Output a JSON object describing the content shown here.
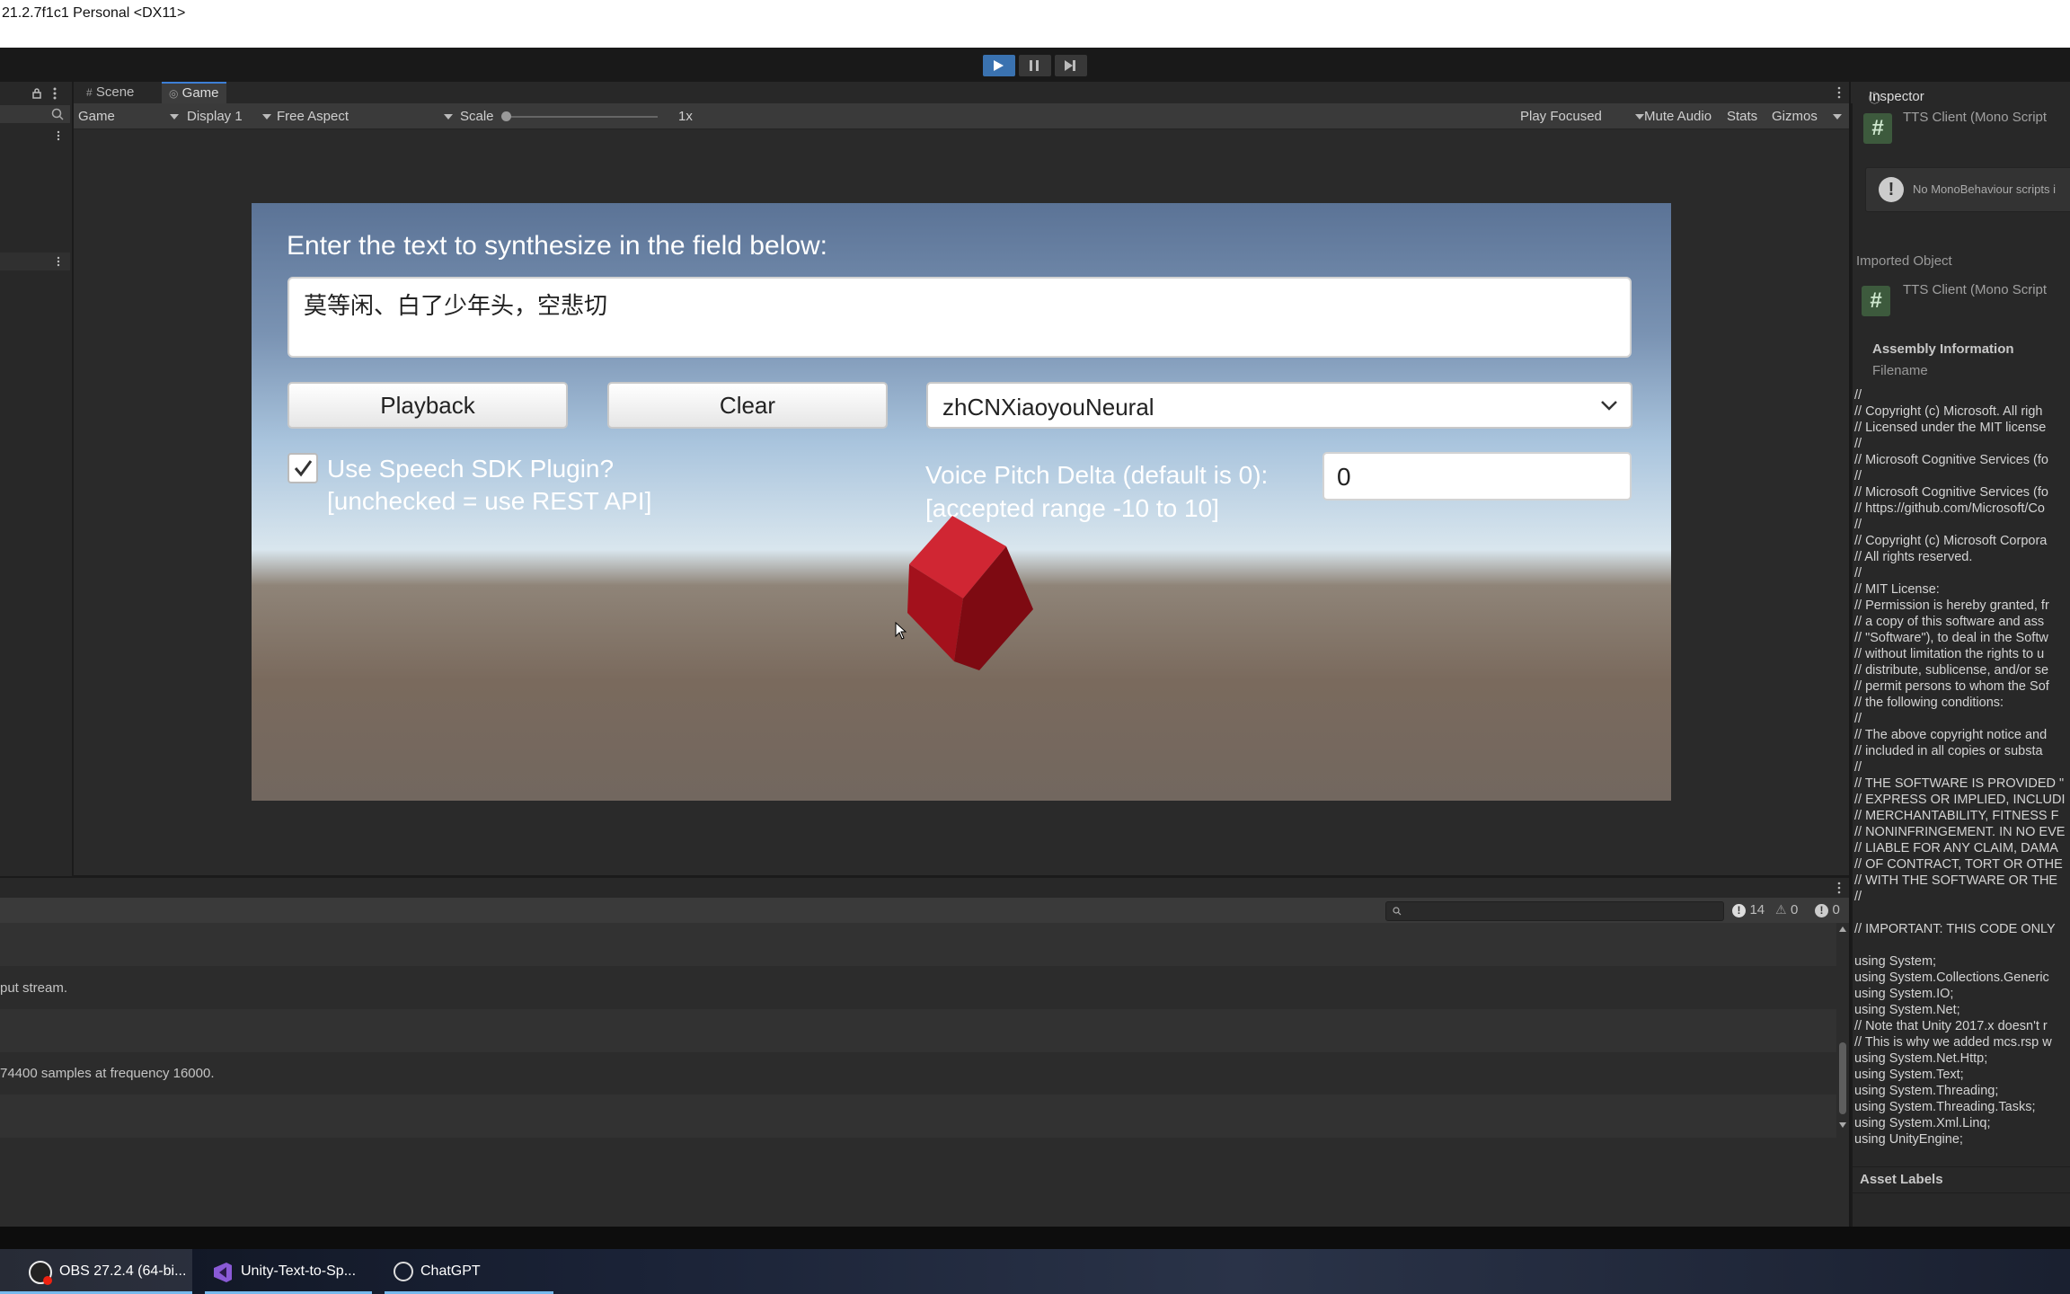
{
  "window": {
    "title": "21.2.7f1c1 Personal <DX11>"
  },
  "game_tabs": {
    "scene": "Scene",
    "game": "Game"
  },
  "game_toolbar": {
    "view": "Game",
    "display": "Display 1",
    "aspect": "Free Aspect",
    "scale_label": "Scale",
    "scale_value": "1x",
    "play_mode": "Play Focused",
    "mute": "Mute Audio",
    "stats": "Stats",
    "gizmos": "Gizmos"
  },
  "game_ui": {
    "prompt": "Enter the text to synthesize in the field below:",
    "input_text": "莫等闲、白了少年头，空悲切",
    "playback_label": "Playback",
    "clear_label": "Clear",
    "voice": "zhCNXiaoyouNeural",
    "sdk_line1": "Use Speech SDK Plugin?",
    "sdk_line2": "[unchecked = use REST API]",
    "pitch_line1": "Voice Pitch Delta (default is 0):",
    "pitch_line2": "[accepted range -10 to 10]",
    "pitch_value": "0"
  },
  "console": {
    "counts": {
      "info": "14",
      "warn": "0",
      "error": "0"
    },
    "rows": [
      "",
      "put stream.",
      "",
      "74400 samples at frequency 16000.",
      "",
      ""
    ]
  },
  "inspector": {
    "tab": "Inspector",
    "title": "TTS Client (Mono Script",
    "warning": "No MonoBehaviour scripts i",
    "imported_object": "Imported Object",
    "title2": "TTS Client (Mono Script",
    "assembly_info": "Assembly Information",
    "filename": "Filename",
    "code": "//\n// Copyright (c) Microsoft. All righ\n// Licensed under the MIT license\n//\n// Microsoft Cognitive Services (fo\n//\n// Microsoft Cognitive Services (fo\n// https://github.com/Microsoft/Co\n//\n// Copyright (c) Microsoft Corpora\n// All rights reserved.\n//\n// MIT License:\n// Permission is hereby granted, fr\n// a copy of this software and ass\n// \"Software\"), to deal in the Softw\n// without limitation the rights to u\n// distribute, sublicense, and/or se\n// permit persons to whom the Sof\n// the following conditions:\n//\n// The above copyright notice and\n// included in all copies or substa\n//\n// THE SOFTWARE IS PROVIDED \"\n// EXPRESS OR IMPLIED, INCLUDI\n// MERCHANTABILITY, FITNESS F\n// NONINFRINGEMENT. IN NO EVE\n// LIABLE FOR ANY CLAIM, DAMA\n// OF CONTRACT, TORT OR OTHE\n// WITH THE SOFTWARE OR THE\n//\n\n// IMPORTANT: THIS CODE ONLY\n\nusing System;\nusing System.Collections.Generic\nusing System.IO;\nusing System.Net;\n// Note that Unity 2017.x doesn't r\n// This is why we added mcs.rsp w\nusing System.Net.Http;\nusing System.Text;\nusing System.Threading;\nusing System.Threading.Tasks;\nusing System.Xml.Linq;\nusing UnityEngine;",
    "asset_labels": "Asset Labels"
  },
  "taskbar": {
    "items": [
      {
        "label": "OBS 27.2.4 (64-bi..."
      },
      {
        "label": "Unity-Text-to-Sp..."
      },
      {
        "label": "ChatGPT"
      }
    ]
  },
  "colors": {
    "accent": "#3a72b0",
    "cube": "#b3141f"
  }
}
